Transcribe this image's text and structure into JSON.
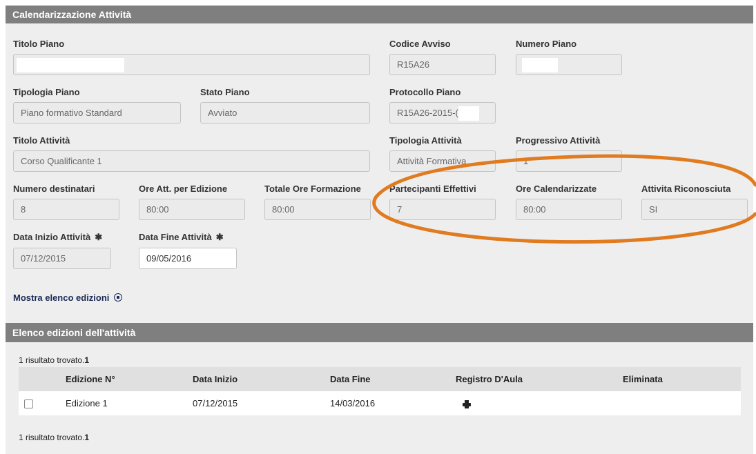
{
  "header": {
    "title": "Calendarizzazione Attività"
  },
  "form": {
    "titolo_piano": {
      "label": "Titolo Piano",
      "value": ""
    },
    "codice_avviso": {
      "label": "Codice Avviso",
      "value": "R15A26"
    },
    "numero_piano": {
      "label": "Numero Piano",
      "value": ""
    },
    "tipologia_piano": {
      "label": "Tipologia Piano",
      "value": "Piano formativo Standard"
    },
    "stato_piano": {
      "label": "Stato Piano",
      "value": "Avviato"
    },
    "protocollo_piano": {
      "label": "Protocollo Piano",
      "value": "R15A26-2015-("
    },
    "titolo_attivita": {
      "label": "Titolo Attività",
      "value": "Corso Qualificante 1"
    },
    "tipologia_attivita": {
      "label": "Tipologia Attività",
      "value": "Attività Formativa"
    },
    "progressivo_attivita": {
      "label": "Progressivo Attività",
      "value": "1"
    },
    "numero_destinatari": {
      "label": "Numero destinatari",
      "value": "8"
    },
    "ore_att_edizione": {
      "label": "Ore Att. per Edizione",
      "value": "80:00"
    },
    "totale_ore_formazione": {
      "label": "Totale Ore Formazione",
      "value": "80:00"
    },
    "partecipanti_effettivi": {
      "label": "Partecipanti Effettivi",
      "value": "7"
    },
    "ore_calendarizzate": {
      "label": "Ore Calendarizzate",
      "value": "80:00"
    },
    "attivita_riconosciuta": {
      "label": "Attivita Riconosciuta",
      "value": "SI"
    },
    "data_inizio": {
      "label": "Data Inizio Attività",
      "value": "07/12/2015"
    },
    "data_fine": {
      "label": "Data Fine Attività",
      "value": "09/05/2016"
    },
    "required_mark": "✱"
  },
  "toggle_link": {
    "label": "Mostra elenco edizioni"
  },
  "editions": {
    "title": "Elenco edizioni dell'attività",
    "result_text": "1 risultato trovato.",
    "result_count": "1",
    "columns": [
      "Edizione N°",
      "Data Inizio",
      "Data Fine",
      "Registro D'Aula",
      "Eliminata"
    ],
    "rows": [
      {
        "edizione": "Edizione 1",
        "data_inizio": "07/12/2015",
        "data_fine": "14/03/2016",
        "registro_icon": "printer-icon",
        "eliminata": ""
      }
    ]
  },
  "annotation": {
    "shape": "ellipse",
    "color": "#e07b20"
  }
}
